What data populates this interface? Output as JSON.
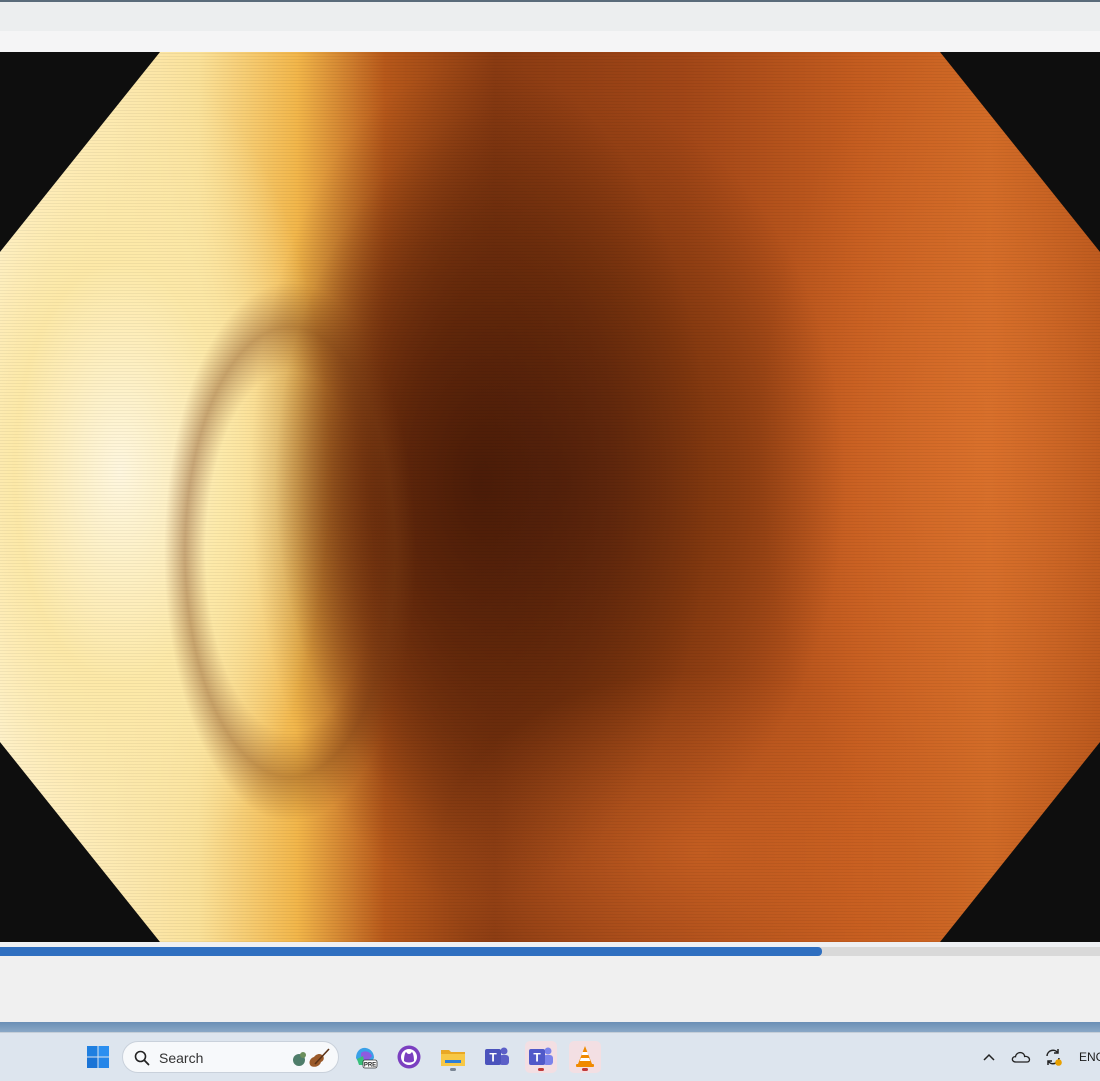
{
  "player": {
    "seek_progress": 0.747,
    "accent_color": "#2f6fc0"
  },
  "taskbar": {
    "search_placeholder": "Search",
    "pinned": [
      {
        "name": "start-icon",
        "active": false
      },
      {
        "name": "copilot-pre-icon",
        "active": false
      },
      {
        "name": "github-desktop-icon",
        "active": false
      },
      {
        "name": "file-explorer-icon",
        "active": false
      },
      {
        "name": "teams-classic-icon",
        "active": false
      },
      {
        "name": "teams-icon",
        "active": true
      },
      {
        "name": "vlc-icon",
        "active": true
      }
    ],
    "tray": {
      "language": "ENG"
    }
  }
}
